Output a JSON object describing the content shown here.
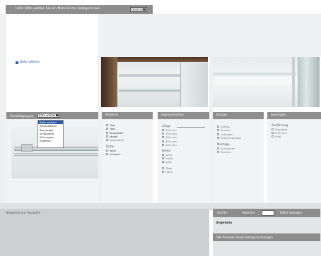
{
  "top_bar": {
    "text": "Hilfe: Bitte wählen Sie ein Material der Kategorie aus",
    "select_value": "Deutsch"
  },
  "language_option": "Bitte wählen",
  "categories": [
    {
      "title": "Produktgruppe",
      "select_value": "Bitte wählen",
      "options": [
        "Bitte wählen",
        "Schubkästen",
        "Beschläge",
        "Scharniere",
        "Führungen",
        "Zubehör"
      ],
      "selected_index": 0
    },
    {
      "title": "Material",
      "items": [
        "Glas",
        "Holz",
        "Kunststoff",
        "Metall",
        "Spanplatte"
      ],
      "group_title": "Farbe",
      "group_items": [
        "weiß",
        "schwarz"
      ]
    },
    {
      "title": "Eigenschaften",
      "heading": "Länge",
      "items": [
        "300 mm",
        "350 mm",
        "400 mm",
        "450 mm",
        "500 mm"
      ],
      "group_title": "Breite",
      "group_items": [
        "klein",
        "mittel",
        "groß"
      ],
      "group2_items": [
        "Tiefe",
        "Höhe"
      ]
    },
    {
      "title": "Einbau",
      "items": [
        "Aufbau",
        "Einbau",
        "Unterbau",
        "Seitenmontage"
      ],
      "group_title": "Montage",
      "group_items": [
        "Schrauben",
        "Stecken"
      ]
    },
    {
      "title": "Sonstiges",
      "heading": "Ausführung",
      "items": [
        "Standard",
        "Premium",
        "Profi"
      ]
    }
  ],
  "bottom": {
    "left_text": "Hinweise zur Auswahl",
    "search_label": "Suchen",
    "search_text": "Nummer",
    "search_button": "Treffer anzeigen",
    "result": "Ergebnis",
    "footer_text": "Alle Produkte dieser Kategorie anzeigen"
  }
}
